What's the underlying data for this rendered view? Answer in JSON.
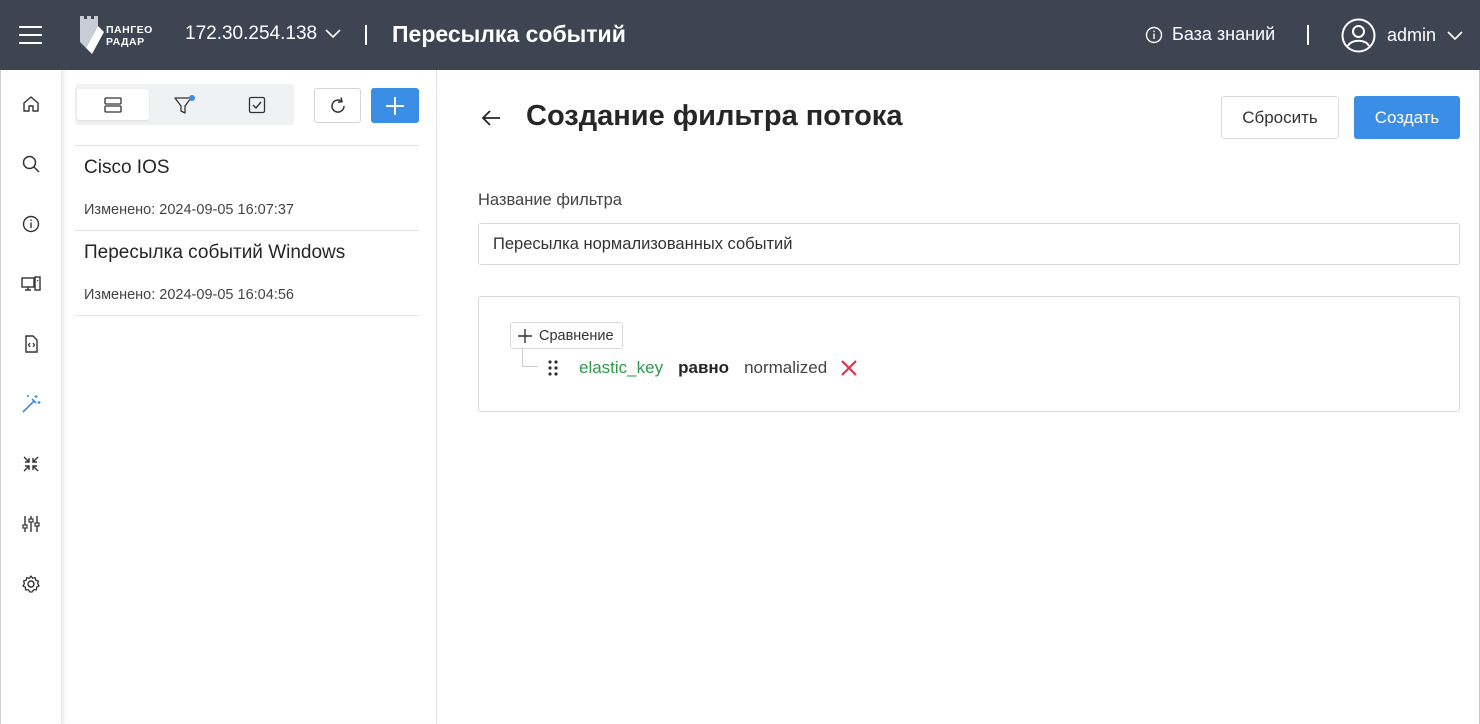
{
  "header": {
    "logo_lines": [
      "ПАНГЕО",
      "РАДАР"
    ],
    "host": "172.30.254.138",
    "title": "Пересылка событий",
    "knowledge_base": "База знаний",
    "user": "admin"
  },
  "nav": {
    "items": [
      "home-icon",
      "search-icon",
      "info-icon",
      "devices-icon",
      "code-file-icon",
      "magic-wand-icon",
      "collapse-icon",
      "sliders-icon",
      "settings-icon"
    ],
    "active": "magic-wand-icon"
  },
  "list_panel": {
    "items": [
      {
        "title": "Cisco IOS",
        "meta": "Изменено: 2024-09-05 16:07:37"
      },
      {
        "title": "Пересылка событий Windows",
        "meta": "Изменено: 2024-09-05 16:04:56"
      }
    ]
  },
  "main": {
    "title": "Создание фильтра потока",
    "reset_label": "Сбросить",
    "create_label": "Создать",
    "name_label": "Название фильтра",
    "name_value": "Пересылка нормализованных событий",
    "add_comparison_label": "Сравнение",
    "rule": {
      "field": "elastic_key",
      "operator": "равно",
      "value": "normalized"
    }
  },
  "colors": {
    "topbar": "#3d4452",
    "accent": "#3a8ee6",
    "field_green": "#2e9a4a",
    "remove_red": "#e0344a"
  }
}
